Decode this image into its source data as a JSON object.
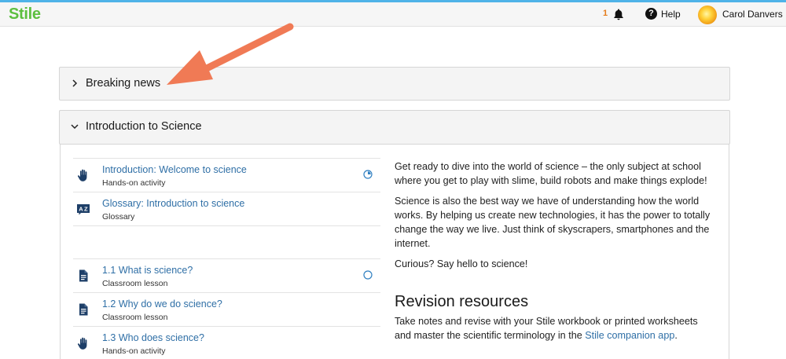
{
  "header": {
    "logo": "Stile",
    "notification_count": "1",
    "help_label": "Help",
    "user_name": "Carol Danvers"
  },
  "sections": [
    {
      "title": "Breaking news",
      "expanded": false
    },
    {
      "title": "Introduction to Science",
      "expanded": true
    }
  ],
  "lessons": [
    {
      "title": "Introduction: Welcome to science",
      "type": "Hands-on activity",
      "icon": "hand-icon",
      "status": "in-progress"
    },
    {
      "title": "Glossary: Introduction to science",
      "type": "Glossary",
      "icon": "glossary-icon",
      "status": ""
    },
    {
      "title": "1.1 What is science?",
      "type": "Classroom lesson",
      "icon": "document-icon",
      "status": "not-started"
    },
    {
      "title": "1.2 Why do we do science?",
      "type": "Classroom lesson",
      "icon": "document-icon",
      "status": ""
    },
    {
      "title": "1.3 Who does science?",
      "type": "Hands-on activity",
      "icon": "hand-icon",
      "status": ""
    }
  ],
  "description": {
    "p1": "Get ready to dive into the world of science – the only subject at school where you get to play with slime, build robots and make things explode!",
    "p2": "Science is also the best way we have of understanding how the world works. By helping us create new technologies, it has the power to totally change the way we live. Just think of skyscrapers, smartphones and the internet.",
    "p3": "Curious? Say hello to science!"
  },
  "revision": {
    "title": "Revision resources",
    "text_before": "Take notes and revise with your Stile workbook or printed worksheets and master the scientific terminology in the ",
    "link": "Stile companion app",
    "text_after": "."
  },
  "colors": {
    "brand": "#5cbf3f",
    "link": "#2f6fa6",
    "annotation_arrow": "#f07a55",
    "notification": "#e47c1a"
  }
}
